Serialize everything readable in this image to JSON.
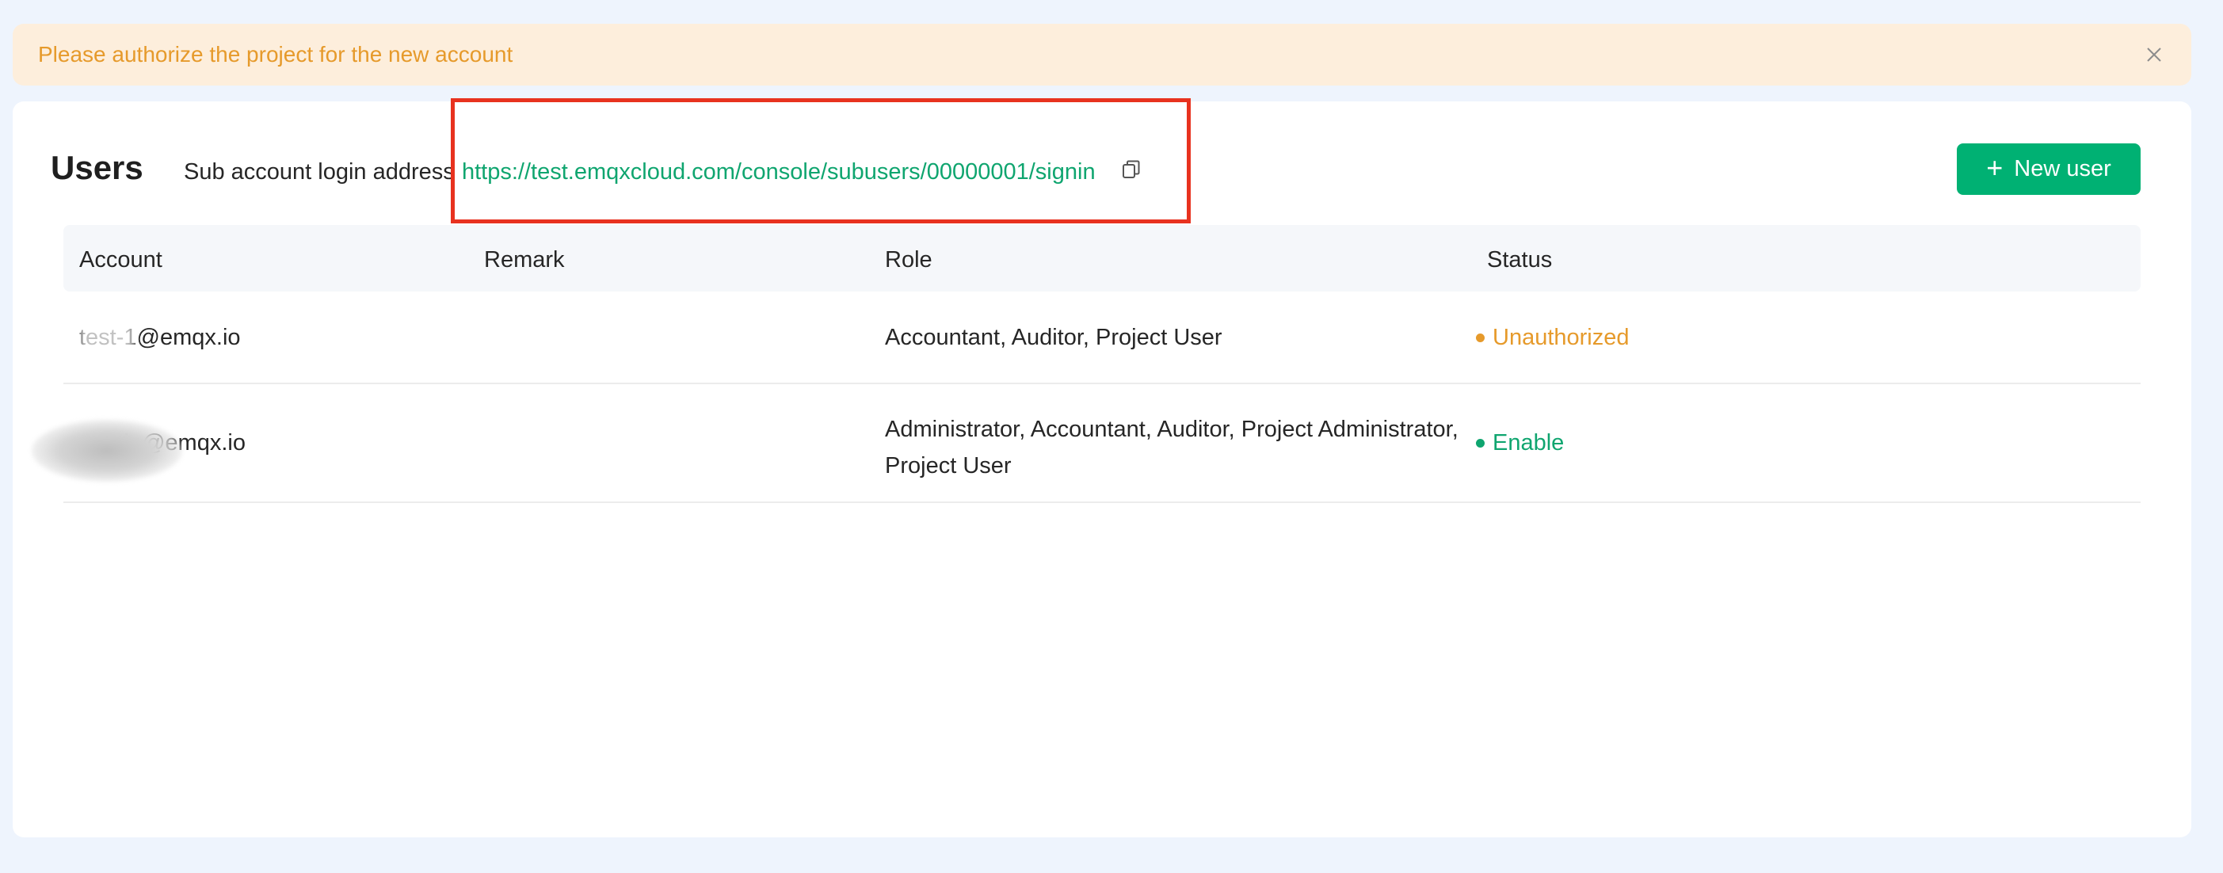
{
  "alert": {
    "message": "Please authorize the project for the new account"
  },
  "header": {
    "title": "Users",
    "subaccount_label": "Sub account login address",
    "subaccount_url": "https://test.emqxcloud.com/console/subusers/00000001/signin",
    "new_user_label": "New user"
  },
  "table": {
    "columns": [
      "Account",
      "Remark",
      "Role",
      "Status"
    ],
    "rows": [
      {
        "account": "test-1@emqx.io",
        "remark": "",
        "role": "Accountant, Auditor, Project User",
        "status": "Unauthorized",
        "status_color": "#e69a2b"
      },
      {
        "account": "admin@emqx.io",
        "remark": "",
        "role_line1": "Administrator, Accountant, Auditor, Project Administrator,",
        "role_line2": "Project User",
        "status": "Enable",
        "status_color": "#0fa56f"
      }
    ]
  },
  "colors": {
    "accent": "#00b173",
    "link": "#0fa56f",
    "warning": "#e69a2b",
    "highlight": "#e8321f"
  },
  "icons": {
    "close": "close-icon",
    "copy": "copy-icon",
    "plus": "plus-icon"
  }
}
